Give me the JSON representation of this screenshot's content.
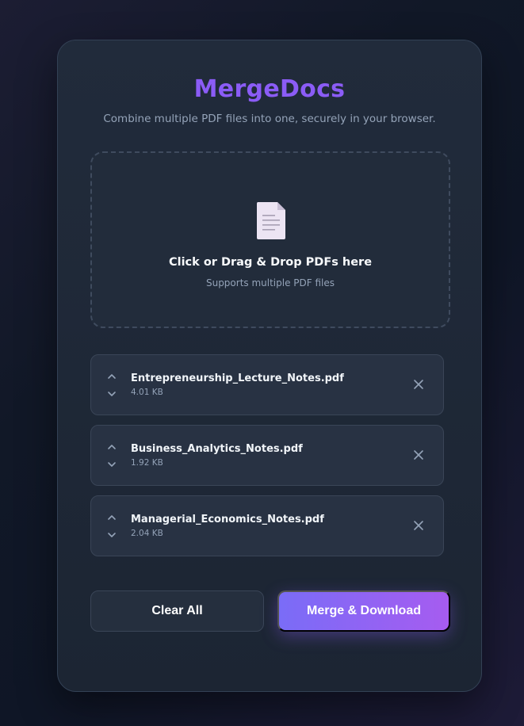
{
  "app": {
    "title": "MergeDocs",
    "subtitle": "Combine multiple PDF files into one, securely in your browser."
  },
  "dropzone": {
    "icon": "document-icon",
    "title": "Click or Drag & Drop PDFs here",
    "subtitle": "Supports multiple PDF files"
  },
  "files": [
    {
      "name": "Entrepreneurship_Lecture_Notes.pdf",
      "size": "4.01 KB"
    },
    {
      "name": "Business_Analytics_Notes.pdf",
      "size": "1.92 KB"
    },
    {
      "name": "Managerial_Economics_Notes.pdf",
      "size": "2.04 KB"
    }
  ],
  "actions": {
    "clear_label": "Clear All",
    "merge_label": "Merge & Download"
  },
  "colors": {
    "brand": "#8b5cf6",
    "merge_gradient_start": "#7a6cf7",
    "merge_gradient_end": "#a65cf0"
  }
}
